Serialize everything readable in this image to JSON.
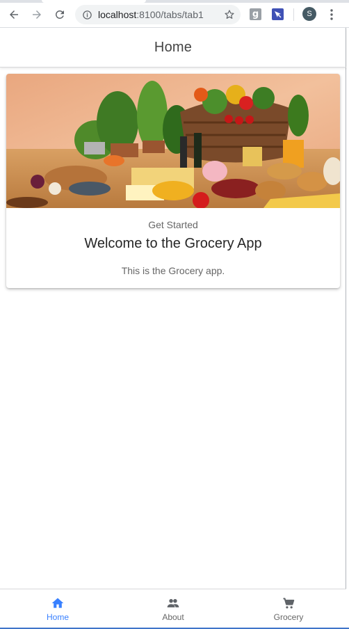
{
  "browser": {
    "url_host": "localhost",
    "url_path": ":8100/tabs/tab1",
    "extension_1": "g",
    "profile_initial": "S"
  },
  "toolbar": {
    "title": "Home"
  },
  "card": {
    "subtitle": "Get Started",
    "title": "Welcome to the Grocery App",
    "content": "This is the Grocery app."
  },
  "tabs": [
    {
      "label": "Home",
      "icon": "home-icon",
      "selected": true
    },
    {
      "label": "About",
      "icon": "people-icon",
      "selected": false
    },
    {
      "label": "Grocery",
      "icon": "cart-icon",
      "selected": false
    }
  ],
  "colors": {
    "accent": "#3880ff",
    "inactive": "#666666"
  }
}
